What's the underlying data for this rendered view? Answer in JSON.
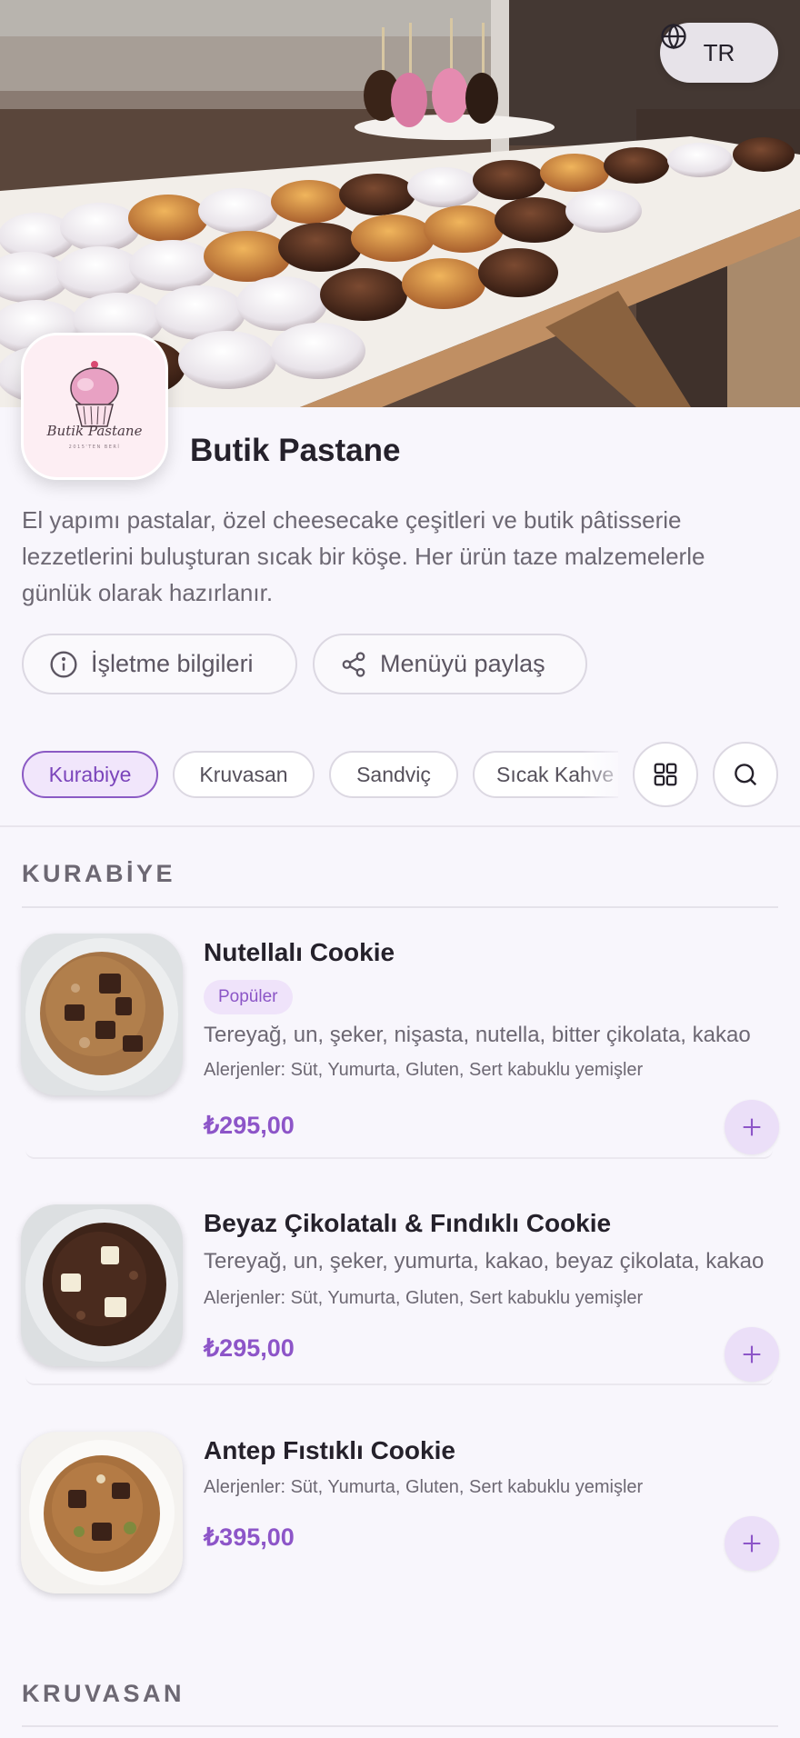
{
  "header": {
    "language": "TR"
  },
  "business": {
    "name": "Butik Pastane",
    "logo_script": "Butik Pastane",
    "logo_sub": "2015'TEN BERİ",
    "description": "El yapımı pastalar, özel cheesecake çeşitleri ve butik pâtisserie lezzetlerini buluşturan sıcak bir köşe. Her ürün taze malzemelerle günlük olarak hazırlanır."
  },
  "actions": {
    "info_label": "İşletme bilgileri",
    "share_label": "Menüyü paylaş"
  },
  "categories": [
    {
      "label": "Kurabiye",
      "active": true
    },
    {
      "label": "Kruvasan",
      "active": false
    },
    {
      "label": "Sandviç",
      "active": false
    },
    {
      "label": "Sıcak Kahve",
      "active": false
    }
  ],
  "sections": [
    {
      "title": "KURABİYE",
      "products": [
        {
          "name": "Nutellalı Cookie",
          "badge": "Popüler",
          "ingredients": "Tereyağ, un, şeker, nişasta, nutella, bitter çikolata, kakao",
          "allergens": "Alerjenler: Süt, Yumurta, Gluten, Sert kabuklu yemişler",
          "price": "₺295,00"
        },
        {
          "name": "Beyaz Çikolatalı & Fındıklı Cookie",
          "ingredients": "Tereyağ, un, şeker, yumurta, kakao, beyaz çikolata, kakao",
          "allergens": "Alerjenler: Süt, Yumurta, Gluten, Sert kabuklu yemişler",
          "price": "₺295,00"
        },
        {
          "name": "Antep Fıstıklı Cookie",
          "allergens": "Alerjenler: Süt, Yumurta, Gluten, Sert kabuklu yemişler",
          "price": "₺395,00"
        }
      ]
    },
    {
      "title": "KRUVASAN"
    }
  ],
  "colors": {
    "accent": "#8d55c8",
    "accent_bg": "#efe3fa",
    "background": "#f8f6fc",
    "text": "#25212b",
    "muted": "#6d6873"
  }
}
